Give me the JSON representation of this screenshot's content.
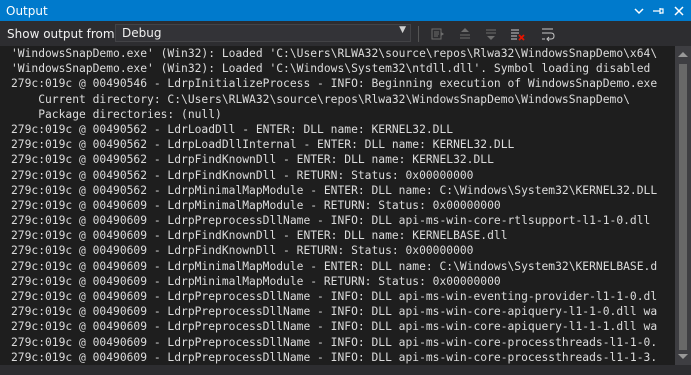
{
  "window": {
    "title": "Output",
    "dropdown_icon": "chevron-down-icon",
    "pin_icon": "pin-icon",
    "close_icon": "close-icon"
  },
  "toolbar": {
    "show_output_label": "Show output from:",
    "source_selected": "Debug",
    "buttons": [
      "find-message-in-code-icon",
      "go-to-previous-message-icon",
      "go-to-next-message-icon",
      "clear-all-icon",
      "toggle-word-wrap-icon"
    ]
  },
  "output": {
    "lines": [
      "'WindowsSnapDemo.exe' (Win32): Loaded 'C:\\Users\\RLWA32\\source\\repos\\Rlwa32\\WindowsSnapDemo\\x64\\",
      "'WindowsSnapDemo.exe' (Win32): Loaded 'C:\\Windows\\System32\\ntdll.dll'. Symbol loading disabled",
      "279c:019c @ 00490546 - LdrpInitializeProcess - INFO: Beginning execution of WindowsSnapDemo.exe",
      "    Current directory: C:\\Users\\RLWA32\\source\\repos\\Rlwa32\\WindowsSnapDemo\\WindowsSnapDemo\\",
      "    Package directories: (null)",
      "279c:019c @ 00490562 - LdrLoadDll - ENTER: DLL name: KERNEL32.DLL",
      "279c:019c @ 00490562 - LdrpLoadDllInternal - ENTER: DLL name: KERNEL32.DLL",
      "279c:019c @ 00490562 - LdrpFindKnownDll - ENTER: DLL name: KERNEL32.DLL",
      "279c:019c @ 00490562 - LdrpFindKnownDll - RETURN: Status: 0x00000000",
      "279c:019c @ 00490562 - LdrpMinimalMapModule - ENTER: DLL name: C:\\Windows\\System32\\KERNEL32.DLL",
      "279c:019c @ 00490609 - LdrpMinimalMapModule - RETURN: Status: 0x00000000",
      "279c:019c @ 00490609 - LdrpPreprocessDllName - INFO: DLL api-ms-win-core-rtlsupport-l1-1-0.dll",
      "279c:019c @ 00490609 - LdrpFindKnownDll - ENTER: DLL name: KERNELBASE.dll",
      "279c:019c @ 00490609 - LdrpFindKnownDll - RETURN: Status: 0x00000000",
      "279c:019c @ 00490609 - LdrpMinimalMapModule - ENTER: DLL name: C:\\Windows\\System32\\KERNELBASE.d",
      "279c:019c @ 00490609 - LdrpMinimalMapModule - RETURN: Status: 0x00000000",
      "279c:019c @ 00490609 - LdrpPreprocessDllName - INFO: DLL api-ms-win-eventing-provider-l1-1-0.dl",
      "279c:019c @ 00490609 - LdrpPreprocessDllName - INFO: DLL api-ms-win-core-apiquery-l1-1-0.dll wa",
      "279c:019c @ 00490609 - LdrpPreprocessDllName - INFO: DLL api-ms-win-core-apiquery-l1-1-1.dll wa",
      "279c:019c @ 00490609 - LdrpPreprocessDllName - INFO: DLL api-ms-win-core-processthreads-l1-1-0.",
      "279c:019c @ 00490609 - LdrpPreprocessDllName - INFO: DLL api-ms-win-core-processthreads-l1-1-3."
    ]
  },
  "colors": {
    "title_bar": "#007acc",
    "toolbar": "#2d2d30",
    "editor_bg": "#1e1e1e",
    "text": "#dcdcdc"
  }
}
